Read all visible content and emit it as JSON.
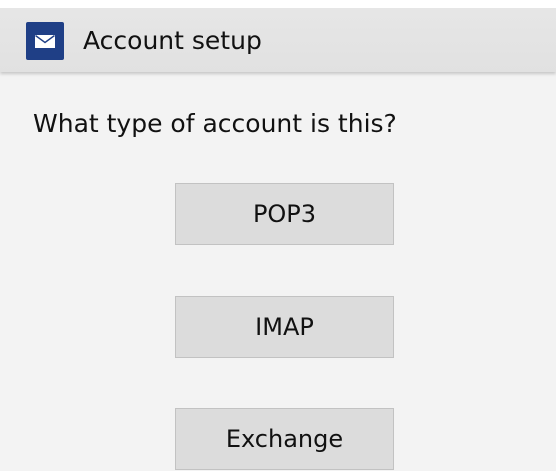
{
  "header": {
    "title": "Account setup",
    "icon": "mail-icon",
    "icon_color": "#1f3f86"
  },
  "main": {
    "prompt": "What type of account is this?",
    "options": [
      {
        "label": "POP3"
      },
      {
        "label": "IMAP"
      },
      {
        "label": "Exchange"
      }
    ]
  }
}
